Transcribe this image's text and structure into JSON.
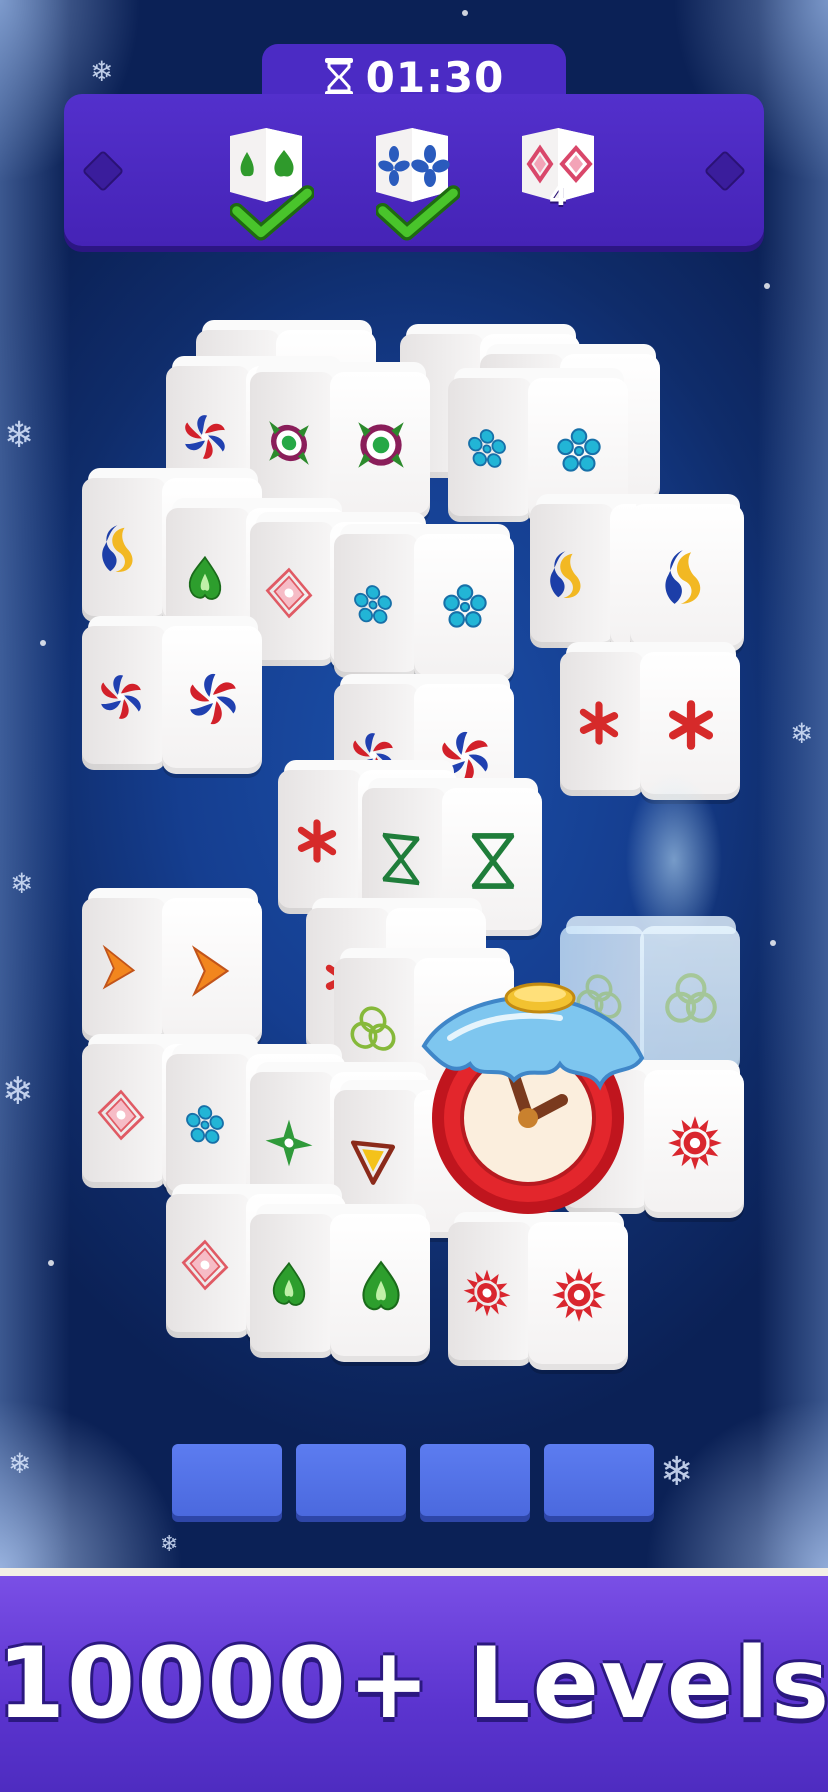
{
  "timer": {
    "icon": "hourglass-icon",
    "value": "01:30"
  },
  "goals": [
    {
      "symbol": "green-spade",
      "completed": true
    },
    {
      "symbol": "blue-petals",
      "completed": true
    },
    {
      "symbol": "pink-diamond",
      "completed": false,
      "remaining": "4"
    }
  ],
  "booster": {
    "icon": "frozen-clock-icon"
  },
  "slots": {
    "count": 4
  },
  "banner": {
    "text": "10000+ Levels"
  },
  "colors": {
    "panel": "#4b2bc4",
    "slot": "#5470e8",
    "banner": "#6a42dc",
    "background": "#153e90"
  }
}
